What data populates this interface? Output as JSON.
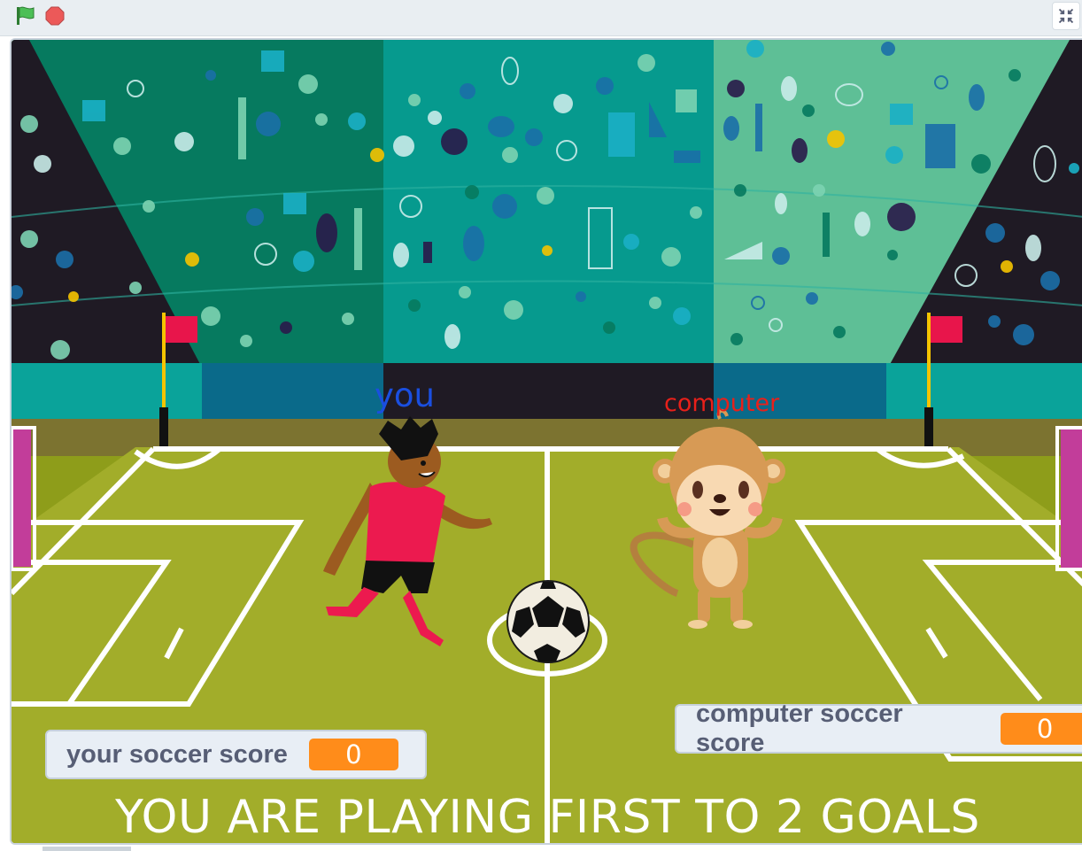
{
  "toolbar": {
    "green_flag_icon": "green-flag-icon",
    "stop_icon": "stop-sign-icon",
    "fullscreen_icon": "exit-fullscreen-icon",
    "colors": {
      "flag": "#3fa33f",
      "stop": "#ec5959"
    }
  },
  "stage": {
    "sprite_labels": {
      "player": "you",
      "opponent": "computer"
    },
    "monitors": {
      "player_score_label": "your soccer score",
      "player_score_value": "0",
      "computer_score_label": "computer soccer score",
      "computer_score_value": "0"
    },
    "message": "YOU ARE PLAYING FIRST TO 2 GOALS",
    "colors": {
      "you_label": "#1a4fe0",
      "computer_label": "#e8201a",
      "score_value_bg": "#ff8c1a",
      "pitch": "#8e9d1a",
      "stands_left": "#067a5f",
      "stands_mid": "#069a8e",
      "stands_right": "#5ebf96"
    }
  }
}
